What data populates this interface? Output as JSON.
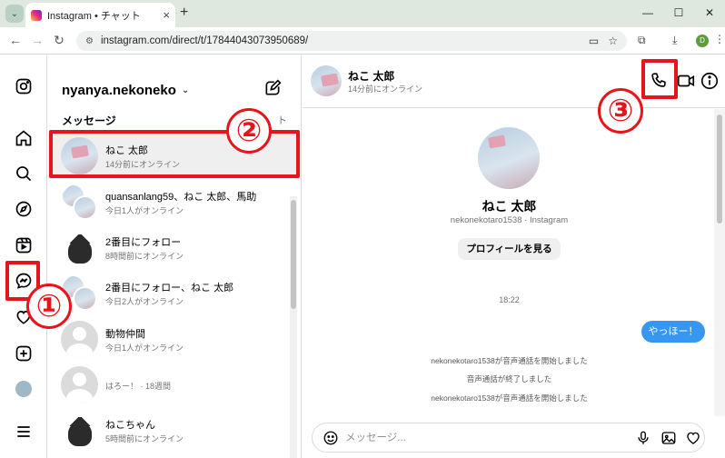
{
  "browser": {
    "tab_title": "Instagram • チャット",
    "tab_close": "×",
    "new_tab": "+",
    "url": "instagram.com/direct/t/17844043073950689/",
    "window_controls": [
      "—",
      "☐",
      "✕"
    ],
    "profile_initial": "D"
  },
  "sidebar": {
    "icons": [
      "instagram-logo-icon",
      "home-icon",
      "search-icon",
      "explore-icon",
      "reels-icon",
      "messenger-icon",
      "heart-icon",
      "create-icon",
      "profile-avatar",
      "menu-icon"
    ]
  },
  "inbox": {
    "username": "nyanya.nekoneko",
    "section_title": "メッセージ",
    "requests_label": "ト",
    "conversations": [
      {
        "name": "ねこ 太郎",
        "status": "14分前にオンライン",
        "avatar": "neko"
      },
      {
        "name": "quansanlang59、ねこ 太郎、馬助",
        "status": "今日1人がオンライン",
        "avatar": "group"
      },
      {
        "name": "2番目にフォロー",
        "status": "8時間前にオンライン",
        "avatar": "cat"
      },
      {
        "name": "2番目にフォロー、ねこ 太郎",
        "status": "今日2人がオンライン",
        "avatar": "group"
      },
      {
        "name": "動物仲間",
        "status": "今日1人がオンライン",
        "avatar": "gray"
      },
      {
        "name": "",
        "status": "はろー！ · 18週間",
        "avatar": "gray"
      },
      {
        "name": "ねこちゃん",
        "status": "5時間前にオンライン",
        "avatar": "cat"
      }
    ]
  },
  "chat": {
    "name": "ねこ 太郎",
    "status": "14分前にオンライン",
    "profile_name": "ねこ 太郎",
    "profile_handle": "nekonekotaro1538 · Instagram",
    "view_profile_button": "プロフィールを見る",
    "timestamp": "18:22",
    "my_message": "やっほー！",
    "system_messages": [
      "nekonekotaro1538が音声通話を開始しました",
      "音声通話が終了しました",
      "nekonekotaro1538が音声通話を開始しました"
    ],
    "composer_placeholder": "メッセージ..."
  },
  "annotations": {
    "step1": "①",
    "step2": "②",
    "step3": "③",
    "color": "#e8141c"
  }
}
